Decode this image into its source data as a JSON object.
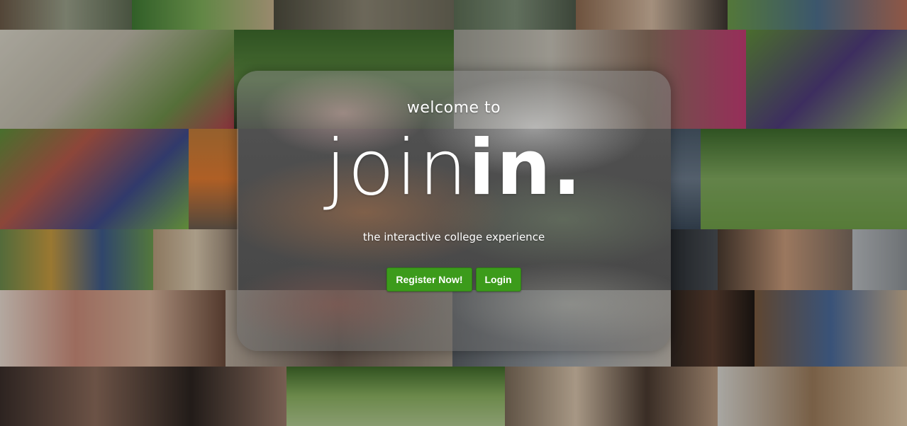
{
  "hero": {
    "welcome": "welcome to",
    "logo_light": "join",
    "logo_bold": "in",
    "logo_dot": ".",
    "tagline": "the interactive college experience"
  },
  "actions": {
    "register_label": "Register Now!",
    "login_label": "Login"
  },
  "colors": {
    "button_green": "#3c9b1b",
    "text": "#ffffff"
  }
}
